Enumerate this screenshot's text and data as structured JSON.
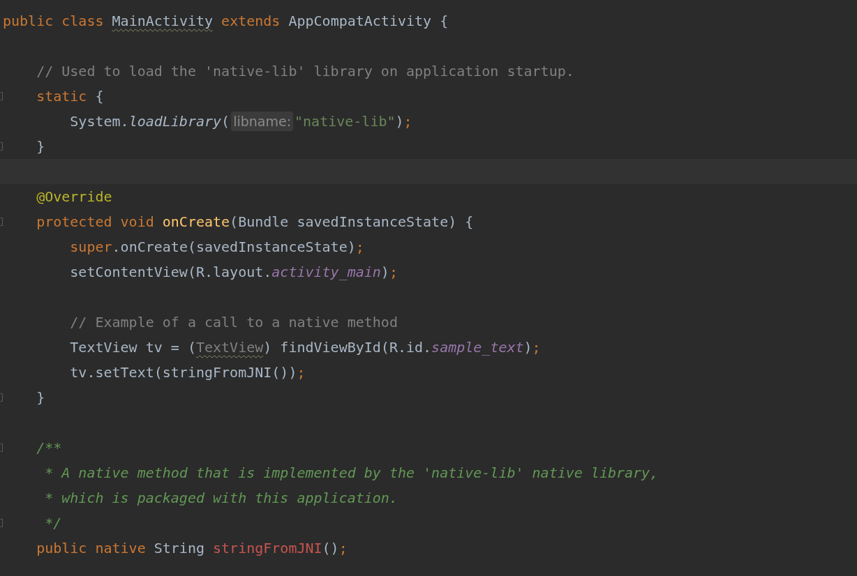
{
  "editor": {
    "lines": [
      {
        "kind": "code",
        "tokens": [
          {
            "kind": "keyword",
            "text": "public class "
          },
          {
            "kind": "plain",
            "text": "MainActivity",
            "warning": true
          },
          {
            "kind": "keyword",
            "text": " extends "
          },
          {
            "kind": "plain",
            "text": "AppCompatActivity {"
          }
        ],
        "children": [
          {
            "kind": "blank"
          },
          {
            "kind": "code",
            "tokens": [
              {
                "kind": "comment",
                "text": "// Used to load the 'native-lib' library on application startup."
              }
            ]
          },
          {
            "kind": "code",
            "fold_marker": true,
            "tokens": [
              {
                "kind": "keyword",
                "text": "static"
              },
              {
                "kind": "plain",
                "text": " {"
              }
            ],
            "children": [
              {
                "kind": "code",
                "tokens": [
                  {
                    "kind": "plain",
                    "text": "System."
                  },
                  {
                    "kind": "static-call",
                    "text": "loadLibrary"
                  },
                  {
                    "kind": "plain",
                    "text": "("
                  },
                  {
                    "kind": "hint",
                    "text": "libname:"
                  },
                  {
                    "kind": "string",
                    "text": "\"native-lib\""
                  },
                  {
                    "kind": "plain",
                    "text": ")"
                  },
                  {
                    "kind": "keyword",
                    "text": ";"
                  }
                ]
              }
            ]
          },
          {
            "kind": "code",
            "fold_marker": true,
            "tokens": [
              {
                "kind": "plain",
                "text": "}"
              }
            ]
          },
          {
            "kind": "blank",
            "current": true
          },
          {
            "kind": "code",
            "tokens": [
              {
                "kind": "annotation",
                "text": "@Override"
              }
            ]
          },
          {
            "kind": "code",
            "fold_marker": true,
            "tokens": [
              {
                "kind": "keyword",
                "text": "protected void "
              },
              {
                "kind": "method-decl",
                "text": "onCreate"
              },
              {
                "kind": "plain",
                "text": "(Bundle savedInstanceState) {"
              }
            ],
            "children": [
              {
                "kind": "code",
                "tokens": [
                  {
                    "kind": "keyword",
                    "text": "super"
                  },
                  {
                    "kind": "plain",
                    "text": ".onCreate(savedInstanceState)"
                  },
                  {
                    "kind": "keyword",
                    "text": ";"
                  }
                ]
              },
              {
                "kind": "code",
                "tokens": [
                  {
                    "kind": "plain",
                    "text": "setContentView(R.layout."
                  },
                  {
                    "kind": "field",
                    "text": "activity_main"
                  },
                  {
                    "kind": "plain",
                    "text": ")"
                  },
                  {
                    "kind": "keyword",
                    "text": ";"
                  }
                ]
              },
              {
                "kind": "blank"
              },
              {
                "kind": "code",
                "tokens": [
                  {
                    "kind": "comment",
                    "text": "// Example of a call to a native method"
                  }
                ]
              },
              {
                "kind": "code",
                "tokens": [
                  {
                    "kind": "plain",
                    "text": "TextView tv = ("
                  },
                  {
                    "kind": "redundant",
                    "text": "TextView",
                    "warning": true
                  },
                  {
                    "kind": "plain",
                    "text": ") findViewById(R.id."
                  },
                  {
                    "kind": "field",
                    "text": "sample_text"
                  },
                  {
                    "kind": "plain",
                    "text": ")"
                  },
                  {
                    "kind": "keyword",
                    "text": ";"
                  }
                ]
              },
              {
                "kind": "code",
                "tokens": [
                  {
                    "kind": "plain",
                    "text": "tv.setText(stringFromJNI())"
                  },
                  {
                    "kind": "keyword",
                    "text": ";"
                  }
                ]
              }
            ]
          },
          {
            "kind": "code",
            "fold_marker": true,
            "tokens": [
              {
                "kind": "plain",
                "text": "}"
              }
            ]
          },
          {
            "kind": "blank"
          },
          {
            "kind": "code",
            "fold_marker": true,
            "tokens": [
              {
                "kind": "doc",
                "text": "/**"
              }
            ]
          },
          {
            "kind": "code",
            "tokens": [
              {
                "kind": "doc",
                "text": " * A native method that is implemented by the 'native-lib' native library,"
              }
            ]
          },
          {
            "kind": "code",
            "tokens": [
              {
                "kind": "doc",
                "text": " * which is packaged with this application."
              }
            ]
          },
          {
            "kind": "code",
            "fold_marker": true,
            "tokens": [
              {
                "kind": "doc",
                "text": " */"
              }
            ]
          },
          {
            "kind": "code",
            "tokens": [
              {
                "kind": "keyword",
                "text": "public native "
              },
              {
                "kind": "plain",
                "text": "String "
              },
              {
                "kind": "native-method",
                "text": "stringFromJNI"
              },
              {
                "kind": "plain",
                "text": "()"
              },
              {
                "kind": "keyword",
                "text": ";"
              }
            ]
          }
        ]
      }
    ]
  }
}
